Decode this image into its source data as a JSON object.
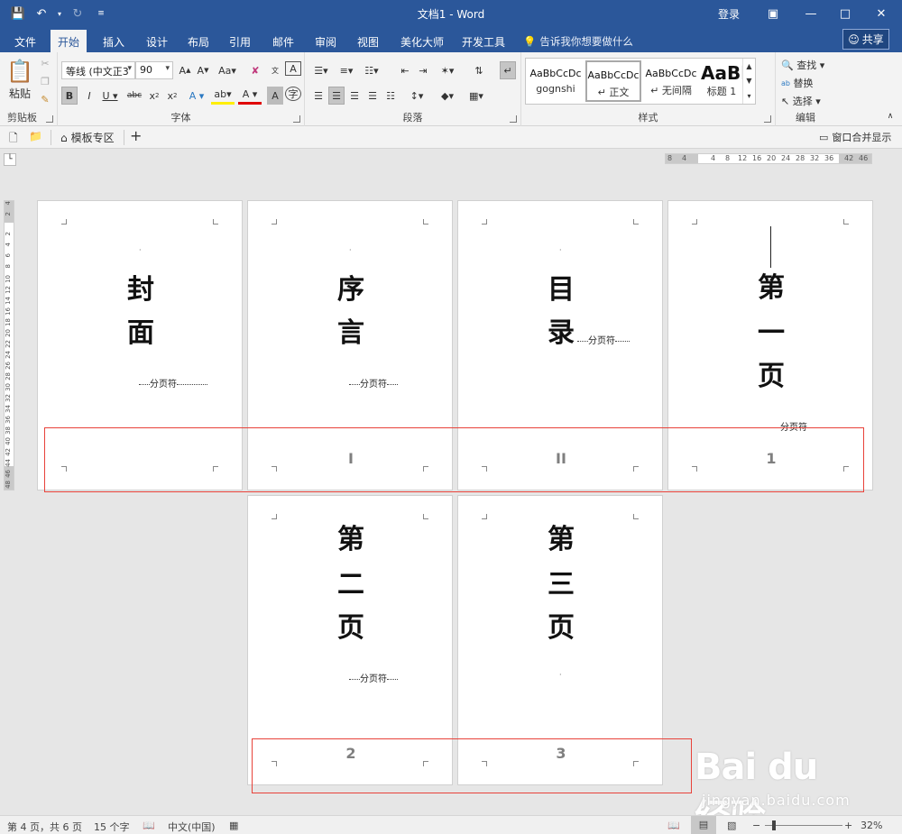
{
  "titlebar": {
    "title": "文档1 - Word",
    "login": "登录",
    "save_icon": "save-icon",
    "undo_icon": "undo-icon",
    "redo_icon": "redo-icon"
  },
  "tabs": {
    "items": [
      "文件",
      "开始",
      "插入",
      "设计",
      "布局",
      "引用",
      "邮件",
      "审阅",
      "视图",
      "美化大师",
      "开发工具"
    ],
    "active": "开始",
    "tell_me": "告诉我你想要做什么",
    "share": "共享"
  },
  "ribbon": {
    "clipboard": {
      "label": "剪贴板",
      "paste": "粘贴"
    },
    "font": {
      "label": "字体",
      "font_name": "等线 (中文正3",
      "font_size": "90"
    },
    "paragraph": {
      "label": "段落"
    },
    "styles": {
      "label": "样式",
      "items": [
        {
          "preview": "AaBbCcDc",
          "name": "gognshi"
        },
        {
          "preview": "AaBbCcDc",
          "name": "↵ 正文"
        },
        {
          "preview": "AaBbCcDc",
          "name": "↵ 无间隔"
        },
        {
          "preview": "AaBl",
          "name": "标题 1"
        }
      ]
    },
    "editing": {
      "label": "编辑",
      "find": "查找",
      "replace": "替换",
      "select": "选择"
    }
  },
  "doctabs": {
    "template": "模板专区",
    "add": "+",
    "merge": "窗口合并显示"
  },
  "ruler": {
    "h": [
      "8",
      "4",
      "4",
      "8",
      "12",
      "16",
      "20",
      "24",
      "28",
      "32",
      "36",
      "42",
      "46"
    ],
    "v": [
      "4",
      "2",
      "2",
      "4",
      "6",
      "8",
      "10",
      "12",
      "14",
      "16",
      "18",
      "20",
      "22",
      "24",
      "26",
      "28",
      "30",
      "32",
      "34",
      "36",
      "38",
      "40",
      "42",
      "44",
      "46",
      "48"
    ]
  },
  "pages": [
    {
      "chars": [
        "封",
        "面"
      ],
      "break": "分页符",
      "number": ""
    },
    {
      "chars": [
        "序",
        "言"
      ],
      "break": "分页符",
      "number": "I"
    },
    {
      "chars": [
        "目",
        "录"
      ],
      "break": "分页符",
      "number": "II"
    },
    {
      "chars": [
        "第",
        "一",
        "页"
      ],
      "break": "分页符",
      "number": "1"
    },
    {
      "chars": [
        "第",
        "二",
        "页"
      ],
      "break": "分页符",
      "number": "2"
    },
    {
      "chars": [
        "第",
        "三",
        "页"
      ],
      "break": "",
      "number": "3"
    }
  ],
  "status": {
    "page": "第 4 页，共 6 页",
    "words": "15 个字",
    "lang": "中文(中国)",
    "zoom": "32%"
  },
  "watermark": {
    "brand": "Bai du 经验",
    "url": "jingyan.baidu.com"
  },
  "colors": {
    "titlebar": "#2b579a",
    "highlight_box": "#e8423a"
  }
}
